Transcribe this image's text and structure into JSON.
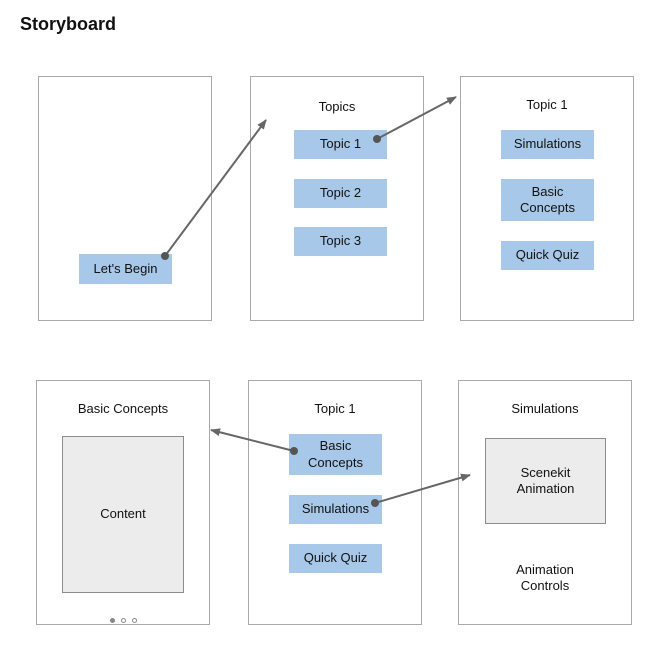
{
  "title": "Storyboard",
  "screens": {
    "start": {
      "button": "Let's Begin"
    },
    "topics": {
      "title": "Topics",
      "items": [
        "Topic 1",
        "Topic 2",
        "Topic 3"
      ]
    },
    "topic1": {
      "title": "Topic 1",
      "items": [
        "Simulations",
        "Basic\nConcepts",
        "Quick Quiz"
      ]
    },
    "basic_concepts": {
      "title": "Basic Concepts",
      "content": "Content",
      "page_dots": 3,
      "active_dot": 0
    },
    "topic1_b": {
      "title": "Topic 1",
      "items": [
        "Basic\nConcepts",
        "Simulations",
        "Quick Quiz"
      ]
    },
    "simulations": {
      "title": "Simulations",
      "animation": "Scenekit\nAnimation",
      "controls": "Animation\nControls"
    }
  },
  "colors": {
    "button": "#a7c8e8",
    "content_box": "#ececec",
    "border": "#a9a9a9",
    "arrow": "#666666"
  }
}
